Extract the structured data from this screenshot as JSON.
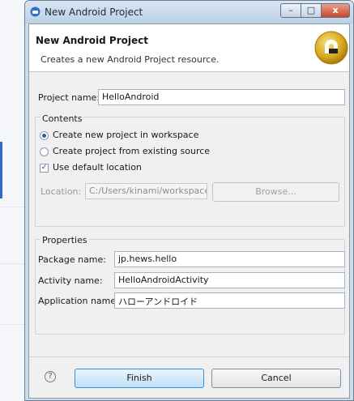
{
  "window": {
    "title": "New Android Project",
    "controls": {
      "minimize": "–",
      "maximize": "□",
      "close": "x"
    }
  },
  "banner": {
    "title": "New Android Project",
    "description": "Creates a new Android Project resource."
  },
  "project": {
    "label": "Project name:",
    "value": "HelloAndroid"
  },
  "contents": {
    "label": "Contents",
    "radio_new": "Create new project in workspace",
    "radio_new_selected": true,
    "radio_existing": "Create project from existing source",
    "use_default": "Use default location",
    "use_default_checked": true,
    "location_label": "Location:",
    "location_value": "C:/Users/kinami/workspace",
    "browse": "Browse..."
  },
  "properties": {
    "label": "Properties",
    "package_label": "Package name:",
    "package_value": "jp.hews.hello",
    "activity_label": "Activity name:",
    "activity_value": "HelloAndroidActivity",
    "app_label": "Application name:",
    "app_value": "ハローアンドロイド"
  },
  "footer": {
    "help": "?",
    "finish": "Finish",
    "cancel": "Cancel"
  },
  "colors": {
    "primary_button": "#bfe0f7",
    "titlebar": "#bcd0e4",
    "close_button": "#c8462b"
  },
  "icons": [
    "android-window-icon",
    "android-logo-icon",
    "help-icon"
  ]
}
